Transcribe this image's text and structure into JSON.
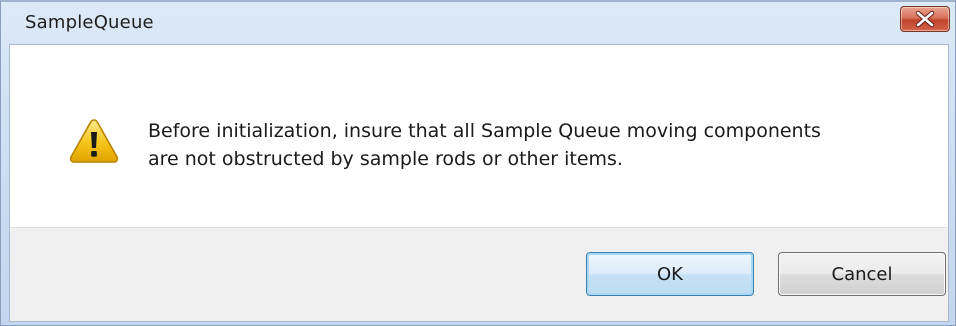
{
  "window": {
    "title": "SampleQueue",
    "close_icon": "close-icon"
  },
  "message": {
    "icon": "warning-icon",
    "line1": "Before initialization, insure that all Sample Queue moving components",
    "line2": "are not obstructed by sample rods or other items."
  },
  "buttons": {
    "ok_label": "OK",
    "cancel_label": "Cancel"
  },
  "colors": {
    "titlebar": "#c9dcf2",
    "close_button": "#c0442c",
    "warning_fill": "#f5c518",
    "default_button_border": "#3c7fb1"
  }
}
